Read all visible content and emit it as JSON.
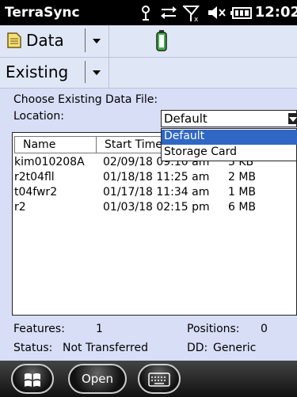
{
  "status_bar": {
    "app_name": "TerraSync",
    "time": "12:02",
    "icons": [
      "signal-icon",
      "sync-icon",
      "no-signal-icon",
      "volume-icon",
      "battery-icon"
    ]
  },
  "toolbar1": {
    "section_label": "Data",
    "gps_icon": "battery-gps-icon"
  },
  "toolbar2": {
    "mode_label": "Existing"
  },
  "main": {
    "choose_label": "Choose Existing Data File:",
    "location_label": "Location:",
    "location_value": "Default",
    "location_options": [
      "Default",
      "Storage Card"
    ],
    "columns": [
      "Name",
      "Start Time",
      ""
    ],
    "files": [
      {
        "name": "kim010208A",
        "start": "02/09/18 09:10 am",
        "size": "3 KB"
      },
      {
        "name": "r2t04fll",
        "start": "01/18/18 11:25 am",
        "size": "2 MB"
      },
      {
        "name": "t04fwr2",
        "start": "01/17/18 11:34 am",
        "size": "1 MB"
      },
      {
        "name": "r2",
        "start": "01/03/18 02:15 pm",
        "size": "6 MB"
      }
    ]
  },
  "footer": {
    "features_label": "Features:",
    "features_value": "1",
    "positions_label": "Positions:",
    "positions_value": "0",
    "status_label": "Status:",
    "status_value": "Not Transferred",
    "dd_label": "DD:",
    "dd_value": "Generic"
  },
  "bottom_bar": {
    "open_label": "Open",
    "start_icon": "windows-start-icon",
    "keyboard_icon": "keyboard-icon"
  }
}
